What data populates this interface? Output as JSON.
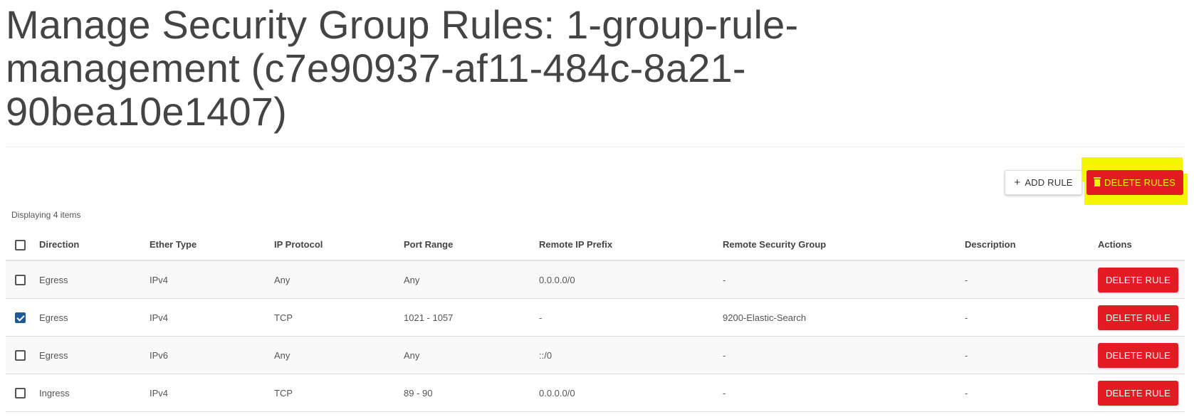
{
  "page": {
    "title": "Manage Security Group Rules: 1-group-rule-management (c7e90937-af11-484c-8a21-90bea10e1407)"
  },
  "toolbar": {
    "add_rule_label": "ADD RULE",
    "add_rule_icon": "plus-icon",
    "delete_rules_label": "DELETE RULES",
    "delete_rules_icon": "trash-icon"
  },
  "table": {
    "count_text": "Displaying 4 items",
    "columns": [
      "Direction",
      "Ether Type",
      "IP Protocol",
      "Port Range",
      "Remote IP Prefix",
      "Remote Security Group",
      "Description",
      "Actions"
    ],
    "rows": [
      {
        "checked": false,
        "direction": "Egress",
        "ether_type": "IPv4",
        "ip_protocol": "Any",
        "port_range": "Any",
        "remote_ip_prefix": "0.0.0.0/0",
        "remote_security_group": "-",
        "description": "-",
        "action_label": "DELETE RULE"
      },
      {
        "checked": true,
        "direction": "Egress",
        "ether_type": "IPv4",
        "ip_protocol": "TCP",
        "port_range": "1021 - 1057",
        "remote_ip_prefix": "-",
        "remote_security_group": "9200-Elastic-Search",
        "description": "-",
        "action_label": "DELETE RULE"
      },
      {
        "checked": false,
        "direction": "Egress",
        "ether_type": "IPv6",
        "ip_protocol": "Any",
        "port_range": "Any",
        "remote_ip_prefix": "::/0",
        "remote_security_group": "-",
        "description": "-",
        "action_label": "DELETE RULE"
      },
      {
        "checked": false,
        "direction": "Ingress",
        "ether_type": "IPv4",
        "ip_protocol": "TCP",
        "port_range": "89 - 90",
        "remote_ip_prefix": "0.0.0.0/0",
        "remote_security_group": "-",
        "description": "-",
        "action_label": "DELETE RULE"
      }
    ]
  },
  "colors": {
    "danger": "#e31c24",
    "highlight": "#f5f500",
    "checkbox_checked": "#1e5a96"
  }
}
